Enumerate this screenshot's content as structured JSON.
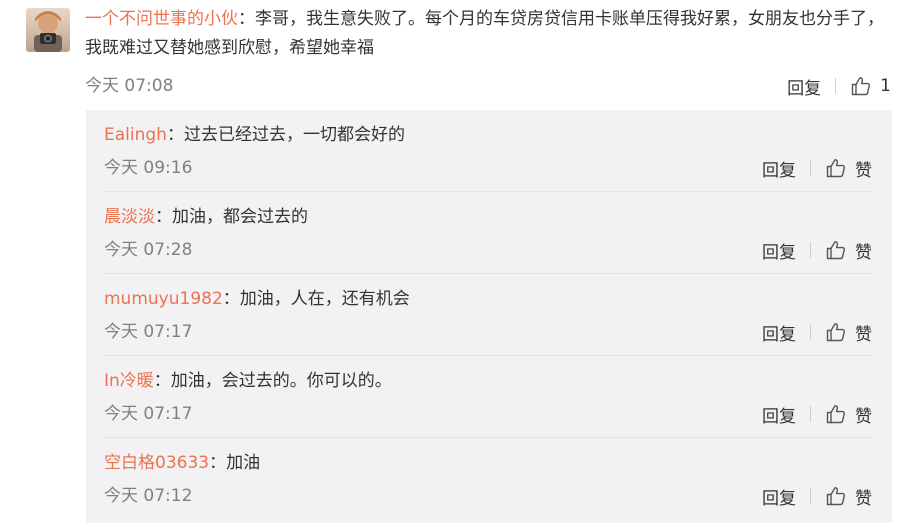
{
  "main_comment": {
    "username": "一个不问世事的小伙",
    "separator": "：",
    "text": "李哥，我生意失败了。每个月的车贷房贷信用卡账单压得我好累，女朋友也分手了，我既难过又替她感到欣慰，希望她幸福",
    "time": "今天 07:08",
    "reply_label": "回复",
    "like_count": "1"
  },
  "replies": [
    {
      "username": "Ealingh",
      "separator": "：",
      "text": "过去已经过去，一切都会好的",
      "time": "今天 09:16",
      "reply_label": "回复",
      "like_label": "赞"
    },
    {
      "username": "晨淡淡",
      "separator": "：",
      "text": "加油，都会过去的",
      "time": "今天 07:28",
      "reply_label": "回复",
      "like_label": "赞"
    },
    {
      "username": "mumuyu1982",
      "separator": "：",
      "text": "加油，人在，还有机会",
      "time": "今天 07:17",
      "reply_label": "回复",
      "like_label": "赞"
    },
    {
      "username": "In冷暖",
      "separator": "：",
      "text": "加油，会过去的。你可以的。",
      "time": "今天 07:17",
      "reply_label": "回复",
      "like_label": "赞"
    },
    {
      "username": "空白格03633",
      "separator": "：",
      "text": "加油",
      "time": "今天 07:12",
      "reply_label": "回复",
      "like_label": "赞"
    }
  ],
  "colors": {
    "username": "#eb7350",
    "text": "#333333",
    "meta": "#808080",
    "reply_panel_bg": "#f2f2f5",
    "divider": "#e3e3e6"
  },
  "icons": {
    "like": "thumbs-up-icon",
    "avatar": "user-avatar"
  }
}
